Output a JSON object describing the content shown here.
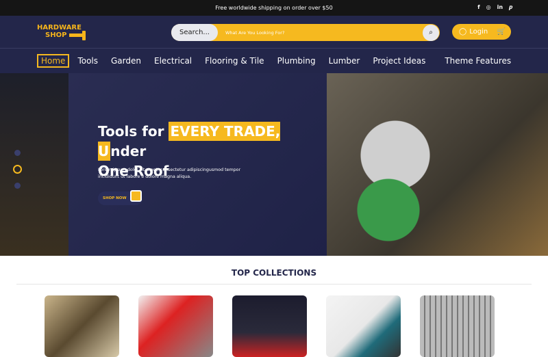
{
  "topbar": {
    "text": "Free worldwide shipping on order over $50",
    "social": [
      "f",
      "◎",
      "in",
      "𝒑"
    ]
  },
  "header": {
    "logo_line1": "HARDWARE",
    "logo_line2": "SHOP",
    "search_label": "Search...",
    "search_placeholder": "What Are You Looking For?",
    "search_icon": "⌕",
    "login": "Login",
    "user_icon": "◯",
    "cart_icon": "🛒"
  },
  "nav": [
    "Home",
    "Tools",
    "Garden",
    "Electrical",
    "Flooring & Tile",
    "Plumbing",
    "Lumber",
    "Project Ideas",
    "Theme Features"
  ],
  "hero": {
    "title_a": "Tools for ",
    "title_hl": "EVERY TRADE, U",
    "title_b": "nder",
    "title_c": "One Roof",
    "description": "Lorem ipsum dolor sit amet, consectetur adipiscingusmod tempor incididunt ut labore e dolore magna aliqua.",
    "cta": "SHOP NOW",
    "active_slide": 2,
    "slides": 3
  },
  "collections": {
    "title": "TOP COLLECTIONS"
  },
  "colors": {
    "accent": "#f6b91f",
    "navy": "#23264a"
  }
}
